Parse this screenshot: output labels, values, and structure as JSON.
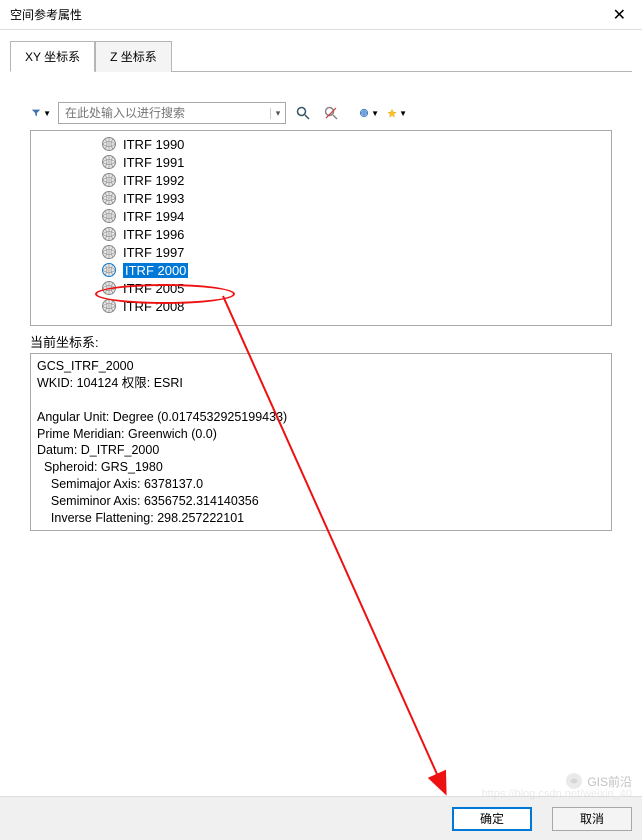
{
  "window": {
    "title": "空间参考属性"
  },
  "tabs": {
    "xy": "XY 坐标系",
    "z": "Z 坐标系"
  },
  "toolbar": {
    "search_placeholder": "在此处输入以进行搜索"
  },
  "tree": {
    "items": [
      {
        "label": "ITRF 1990",
        "selected": false
      },
      {
        "label": "ITRF 1991",
        "selected": false
      },
      {
        "label": "ITRF 1992",
        "selected": false
      },
      {
        "label": "ITRF 1993",
        "selected": false
      },
      {
        "label": "ITRF 1994",
        "selected": false
      },
      {
        "label": "ITRF 1996",
        "selected": false
      },
      {
        "label": "ITRF 1997",
        "selected": false
      },
      {
        "label": "ITRF 2000",
        "selected": true
      },
      {
        "label": "ITRF 2005",
        "selected": false
      },
      {
        "label": "ITRF 2008",
        "selected": false
      }
    ]
  },
  "current_cs": {
    "label": "当前坐标系:",
    "lines": {
      "l1": "GCS_ITRF_2000",
      "l2": "WKID: 104124 权限: ESRI",
      "l3": "",
      "l4": "Angular Unit: Degree (0.0174532925199433)",
      "l5": "Prime Meridian: Greenwich (0.0)",
      "l6": "Datum: D_ITRF_2000",
      "l7": "  Spheroid: GRS_1980",
      "l8": "    Semimajor Axis: 6378137.0",
      "l9": "    Semiminor Axis: 6356752.314140356",
      "l10": "    Inverse Flattening: 298.257222101"
    }
  },
  "buttons": {
    "ok": "确定",
    "cancel": "取消"
  },
  "watermark": {
    "main": "GIS前沿",
    "sub": "https://blog.csdn.net/weixin_40"
  }
}
